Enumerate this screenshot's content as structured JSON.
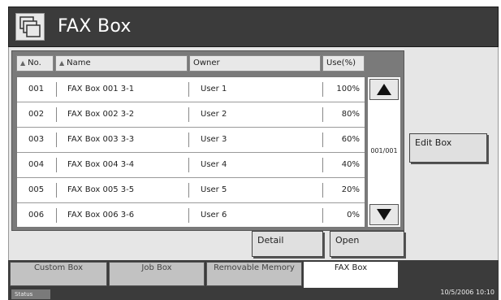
{
  "header": {
    "title": "FAX Box"
  },
  "table": {
    "columns": {
      "no": "No.",
      "name": "Name",
      "owner": "Owner",
      "use": "Use(%)"
    },
    "rows": [
      {
        "no": "001",
        "name": "FAX Box 001 3-1",
        "owner": "User 1",
        "use": "100%"
      },
      {
        "no": "002",
        "name": "FAX Box 002 3-2",
        "owner": "User 2",
        "use": "80%"
      },
      {
        "no": "003",
        "name": "FAX Box 003 3-3",
        "owner": "User 3",
        "use": "60%"
      },
      {
        "no": "004",
        "name": "FAX Box 004 3-4",
        "owner": "User 4",
        "use": "40%"
      },
      {
        "no": "005",
        "name": "FAX Box 005 3-5",
        "owner": "User 5",
        "use": "20%"
      },
      {
        "no": "006",
        "name": "FAX Box 006 3-6",
        "owner": "User 6",
        "use": "0%"
      }
    ]
  },
  "scroll": {
    "page_counter": "001/001"
  },
  "buttons": {
    "edit_box": "Edit Box",
    "detail": "Detail",
    "open": "Open"
  },
  "tabs": [
    "Custom Box",
    "Job Box",
    "Removable Memory",
    "FAX Box"
  ],
  "status": {
    "label": "Status",
    "datetime": "10/5/2006   10:10"
  }
}
